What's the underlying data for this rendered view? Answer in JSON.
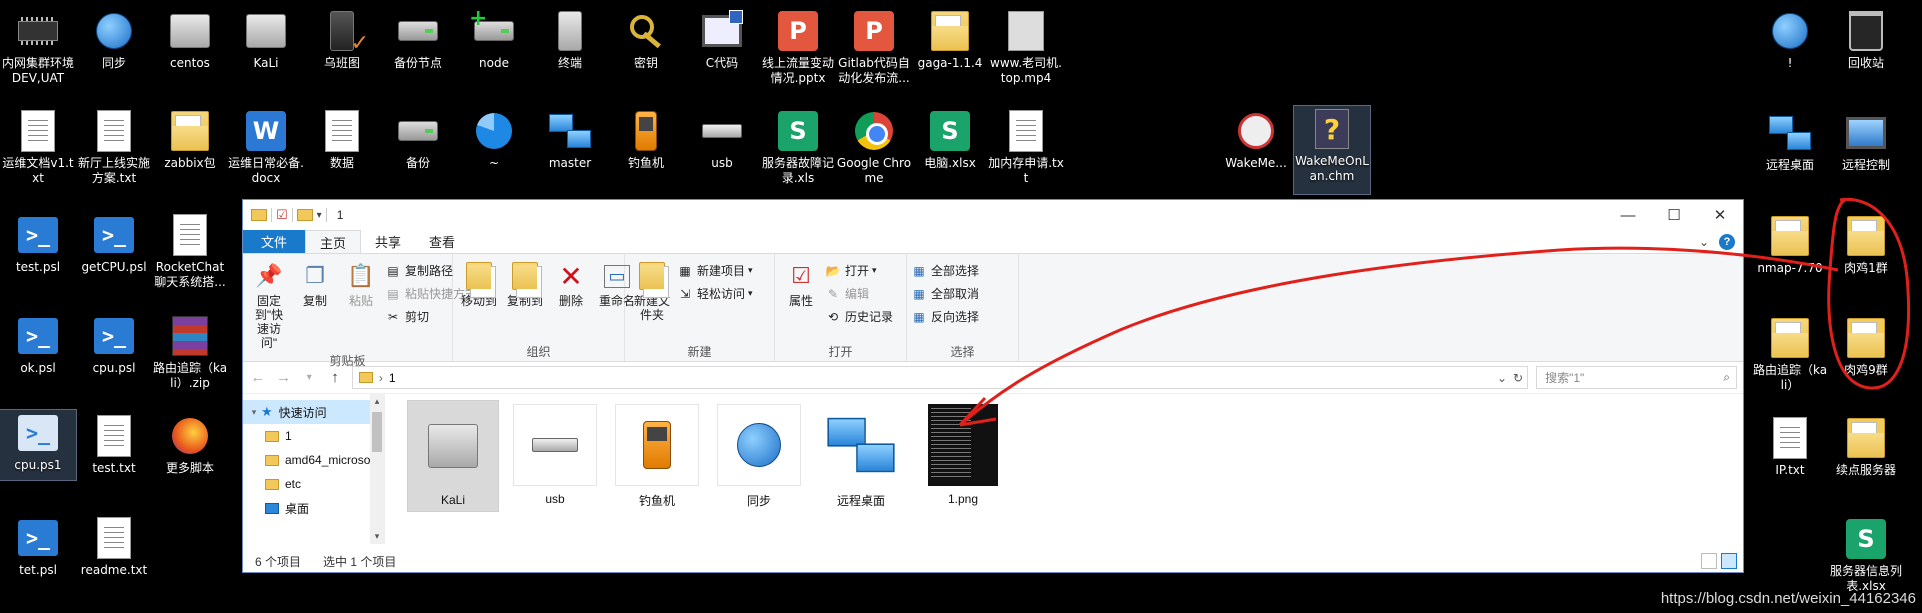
{
  "desktop": {
    "icons": [
      {
        "label": "内网集群环境DEV,UAT",
        "icon": "chip-icon"
      },
      {
        "label": "同步",
        "icon": "sync-icon"
      },
      {
        "label": "centos",
        "icon": "server-icon"
      },
      {
        "label": "KaLi",
        "icon": "server-icon"
      },
      {
        "label": "乌班图",
        "icon": "tower-icon"
      },
      {
        "label": "备份节点",
        "icon": "drive-icon"
      },
      {
        "label": "node",
        "icon": "drive-plus-icon"
      },
      {
        "label": "终端",
        "icon": "terminal-icon"
      },
      {
        "label": "密钥",
        "icon": "key-icon"
      },
      {
        "label": "C代码",
        "icon": "code-window-icon"
      },
      {
        "label": "线上流量变动情况.pptx",
        "icon": "pptx-icon"
      },
      {
        "label": "Gitlab代码自动化发布流...",
        "icon": "pptx-icon"
      },
      {
        "label": "gaga-1.1.4",
        "icon": "folder-icon"
      },
      {
        "label": "www.老司机.top.mp4",
        "icon": "video-icon"
      },
      {
        "label": "运维文档v1.txt",
        "icon": "text-file-icon"
      },
      {
        "label": "新厅上线实施方案.txt",
        "icon": "text-file-icon"
      },
      {
        "label": "zabbix包",
        "icon": "folder-icon"
      },
      {
        "label": "运维日常必备.docx",
        "icon": "word-icon"
      },
      {
        "label": "数据",
        "icon": "checklist-icon"
      },
      {
        "label": "备份",
        "icon": "drive-icon"
      },
      {
        "label": "~",
        "icon": "pie-icon"
      },
      {
        "label": "master",
        "icon": "network-folder-icon"
      },
      {
        "label": "钓鱼机",
        "icon": "phone-icon"
      },
      {
        "label": "usb",
        "icon": "usb-icon"
      },
      {
        "label": "服务器故障记录.xls",
        "icon": "sheet-icon"
      },
      {
        "label": "Google Chrome",
        "icon": "chrome-icon"
      },
      {
        "label": "电脑.xlsx",
        "icon": "sheet-icon"
      },
      {
        "label": "加内存申请.txt",
        "icon": "text-file-icon"
      },
      {
        "label": "WakeMe...",
        "icon": "clock-icon"
      },
      {
        "label": "WakeMeOnLan.chm",
        "icon": "help-file-icon"
      },
      {
        "label": "test.psl",
        "icon": "powershell-icon"
      },
      {
        "label": "getCPU.psl",
        "icon": "powershell-icon"
      },
      {
        "label": "RocketChat聊天系统搭...",
        "icon": "text-file-icon"
      },
      {
        "label": "ok.psl",
        "icon": "powershell-icon"
      },
      {
        "label": "cpu.psl",
        "icon": "powershell-icon"
      },
      {
        "label": "路由追踪（kali）.zip",
        "icon": "zip-icon"
      },
      {
        "label": "cpu.ps1",
        "icon": "powershell-file-icon"
      },
      {
        "label": "test.txt",
        "icon": "text-file-icon"
      },
      {
        "label": "更多脚本",
        "icon": "firefox-icon"
      },
      {
        "label": "tet.psl",
        "icon": "powershell-icon"
      },
      {
        "label": "readme.txt",
        "icon": "text-file-icon"
      },
      {
        "label": "!",
        "icon": "globe-icon"
      },
      {
        "label": "回收站",
        "icon": "recycle-bin-icon"
      },
      {
        "label": "远程桌面",
        "icon": "remote-desktop-icon"
      },
      {
        "label": "远程控制",
        "icon": "remote-control-icon"
      },
      {
        "label": "nmap-7.70",
        "icon": "folder-icon"
      },
      {
        "label": "肉鸡1群",
        "icon": "folder-icon"
      },
      {
        "label": "路由追踪（kali）",
        "icon": "folder-icon"
      },
      {
        "label": "肉鸡9群",
        "icon": "folder-icon"
      },
      {
        "label": "IP.txt",
        "icon": "text-file-icon"
      },
      {
        "label": "续点服务器",
        "icon": "folder-icon"
      },
      {
        "label": "服务器信息列表.xlsx",
        "icon": "sheet-icon"
      }
    ],
    "colors": {
      "accent": "#1979ca",
      "annotation": "#e0201b",
      "sheet": "#1aa36b",
      "pptx": "#e3573f"
    }
  },
  "explorer": {
    "title": "1",
    "tabs": {
      "file": "文件",
      "home": "主页",
      "share": "共享",
      "view": "查看"
    },
    "ribbon": {
      "clipboard": {
        "title": "剪贴板",
        "pin": "固定到\"快速访问\"",
        "copy": "复制",
        "paste": "粘贴",
        "copy_path": "复制路径",
        "paste_shortcut": "粘贴快捷方式",
        "cut": "剪切"
      },
      "organize": {
        "title": "组织",
        "move_to": "移动到",
        "copy_to": "复制到",
        "delete": "删除",
        "rename": "重命名"
      },
      "new": {
        "title": "新建",
        "new_folder": "新建文件夹",
        "new_item": "新建项目",
        "easy_access": "轻松访问"
      },
      "open": {
        "title": "打开",
        "properties": "属性",
        "open": "打开",
        "edit": "编辑",
        "history": "历史记录"
      },
      "select": {
        "title": "选择",
        "select_all": "全部选择",
        "select_none": "全部取消",
        "invert": "反向选择"
      }
    },
    "address": {
      "path": "1",
      "search_placeholder": "搜索\"1\""
    },
    "nav": {
      "quick_access": "快速访问",
      "items": [
        "1",
        "amd64_microso",
        "etc",
        "桌面"
      ]
    },
    "files": [
      {
        "label": "KaLi",
        "icon": "server-icon"
      },
      {
        "label": "usb",
        "icon": "usb-icon"
      },
      {
        "label": "钓鱼机",
        "icon": "phone-icon"
      },
      {
        "label": "同步",
        "icon": "sync-icon"
      },
      {
        "label": "远程桌面",
        "icon": "remote-desktop-icon"
      },
      {
        "label": "1.png",
        "icon": "image-thumbnail-icon"
      }
    ],
    "status": {
      "count": "6 个项目",
      "selected": "选中 1 个项目"
    }
  },
  "watermark": "https://blog.csdn.net/weixin_44162346"
}
